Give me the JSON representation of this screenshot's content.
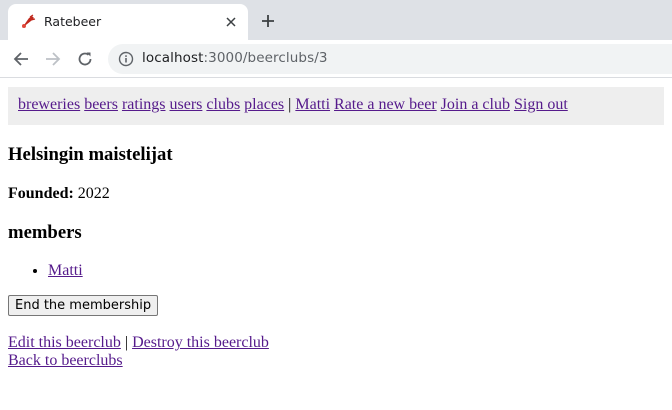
{
  "browser": {
    "tab_title": "Ratebeer",
    "url_host": "localhost",
    "url_path": ":3000/beerclubs/3",
    "icons": [
      "favicon-icon",
      "close-icon",
      "plus-icon",
      "back-arrow-icon",
      "forward-arrow-icon",
      "reload-icon",
      "info-icon"
    ]
  },
  "nav": {
    "links": [
      "breweries",
      "beers",
      "ratings",
      "users",
      "clubs",
      "places"
    ],
    "separator": "|",
    "user_links": [
      "Matti",
      "Rate a new beer",
      "Join a club",
      "Sign out"
    ]
  },
  "club": {
    "name": "Helsingin maistelijat",
    "founded_label": "Founded:",
    "founded_year": "2022",
    "members_heading": "members",
    "members": [
      "Matti"
    ],
    "end_button": "End the membership"
  },
  "footer": {
    "edit": "Edit this beerclub",
    "separator": "|",
    "destroy": "Destroy this beerclub",
    "back": "Back to beerclubs"
  },
  "colors": {
    "visited_link": "#551a8b",
    "navbar_bg": "#eeeeee",
    "tabstrip_bg": "#dee1e6"
  }
}
